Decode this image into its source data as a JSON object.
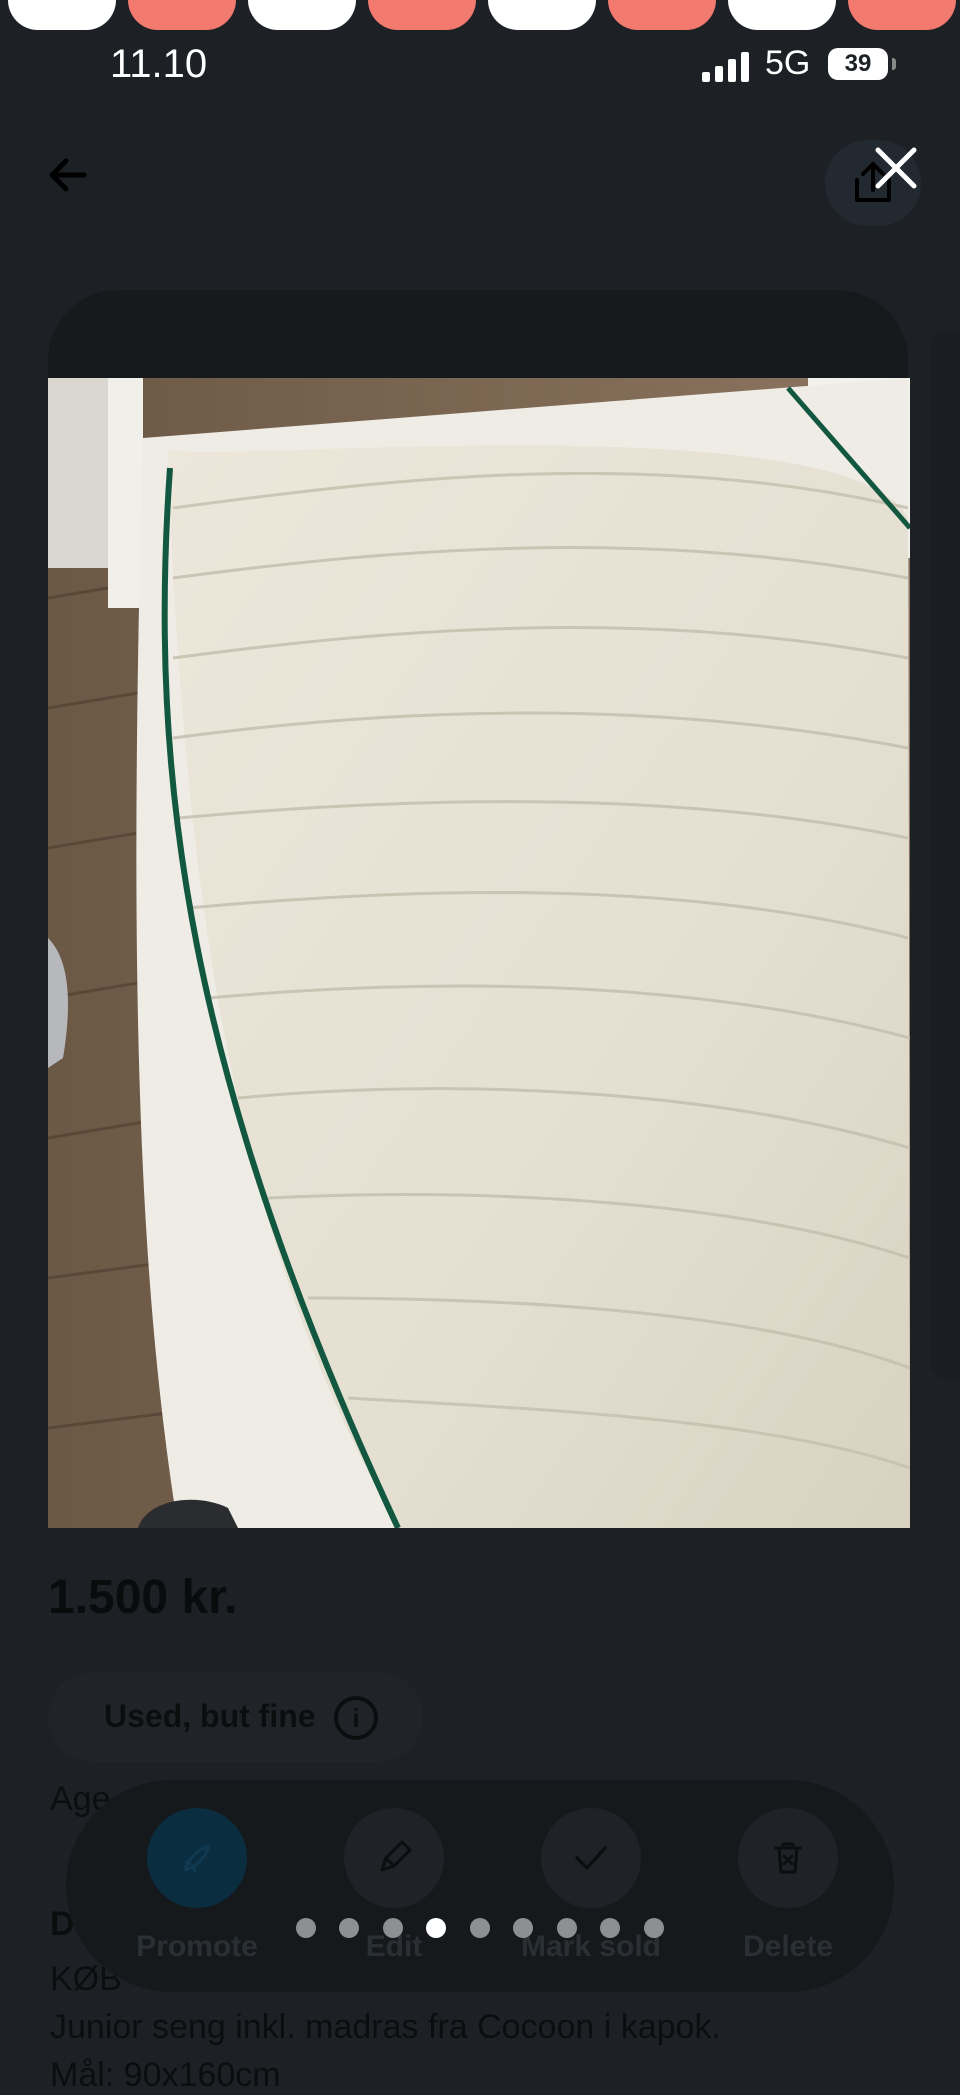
{
  "status_bar": {
    "time": "11.10",
    "network": "5G",
    "battery": "39"
  },
  "listing": {
    "price": "1.500 kr.",
    "condition": "Used, but fine",
    "age_label": "Age",
    "description_heading": "D",
    "description_lines": [
      "KØB",
      "Junior seng inkl. madras fra Cocoon i kapok.",
      "Mål: 90x160cm"
    ]
  },
  "actions": [
    {
      "label": "Promote",
      "icon": "rocket-icon"
    },
    {
      "label": "Edit",
      "icon": "pencil-icon"
    },
    {
      "label": "Mark sold",
      "icon": "check-icon"
    },
    {
      "label": "Delete",
      "icon": "trash-icon"
    }
  ],
  "gallery": {
    "image_count": 9,
    "current_index": 4,
    "image_subject": "white quilted mattress with green piping on a wooden floor"
  }
}
